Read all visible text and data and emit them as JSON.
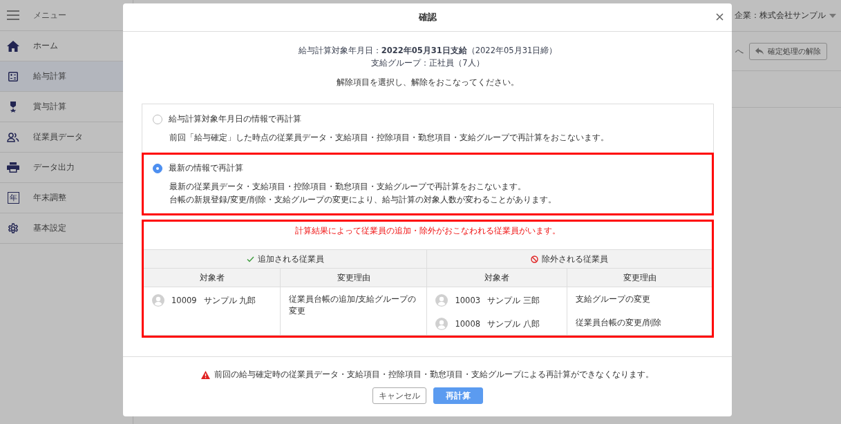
{
  "sidebar": {
    "title": "メニュー",
    "items": [
      {
        "label": "ホーム",
        "selected": false
      },
      {
        "label": "給与計算",
        "selected": true
      },
      {
        "label": "賞与計算",
        "selected": false
      },
      {
        "label": "従業員データ",
        "selected": false
      },
      {
        "label": "データ出力",
        "selected": false
      },
      {
        "label": "年末調整",
        "icon_text": "年",
        "selected": false
      },
      {
        "label": "基本設定",
        "selected": false
      }
    ]
  },
  "header": {
    "company": "企業：株式会社サンプル"
  },
  "toolbar": {
    "link": "へ",
    "button": "確定処理の解除"
  },
  "dialog": {
    "title": "確認",
    "info": [
      "給与計算対象年月日：**2022年05月31日支給**（2022年05月31日締）",
      "支給グループ：正社員（7人）"
    ],
    "instruction": "解除項目を選択し、解除をおこなってください。",
    "options": [
      {
        "label": "給与計算対象年月日の情報で再計算",
        "selected": false,
        "highlighted": false,
        "description": [
          "前回「給与確定」した時点の従業員データ・支給項目・控除項目・勤怠項目・支給グループで再計算をおこないます。"
        ]
      },
      {
        "label": "最新の情報で再計算",
        "selected": true,
        "highlighted": true,
        "description": [
          "最新の従業員データ・支給項目・控除項目・勤怠項目・支給グループで再計算をおこないます。",
          "台帳の新規登録/変更/削除・支給グループの変更により、給与計算の対象人数が変わることがあります。"
        ]
      }
    ],
    "result": {
      "highlighted": true,
      "notice": "計算結果によって従業員の追加・除外がおこなわれる従業員がいます。",
      "groups": [
        {
          "title": "追加される従業員",
          "columns": [
            "対象者",
            "変更理由"
          ],
          "rows": [
            {
              "id": "10009",
              "name": "サンプル 九郎",
              "reason": "従業員台帳の追加/支給グループの変更"
            }
          ]
        },
        {
          "title": "除外される従業員",
          "columns": [
            "対象者",
            "変更理由"
          ],
          "rows": [
            {
              "id": "10003",
              "name": "サンプル 三郎",
              "reason": "支給グループの変更"
            },
            {
              "id": "10008",
              "name": "サンプル 八郎",
              "reason": "従業員台帳の変更/削除"
            }
          ]
        }
      ]
    },
    "warning": "前回の給与確定時の従業員データ・支給項目・控除項目・勤怠項目・支給グループによる再計算ができなくなります。",
    "buttons": [
      {
        "label": "キャンセル",
        "kind": "secondary"
      },
      {
        "label": "再計算",
        "kind": "primary"
      }
    ]
  }
}
